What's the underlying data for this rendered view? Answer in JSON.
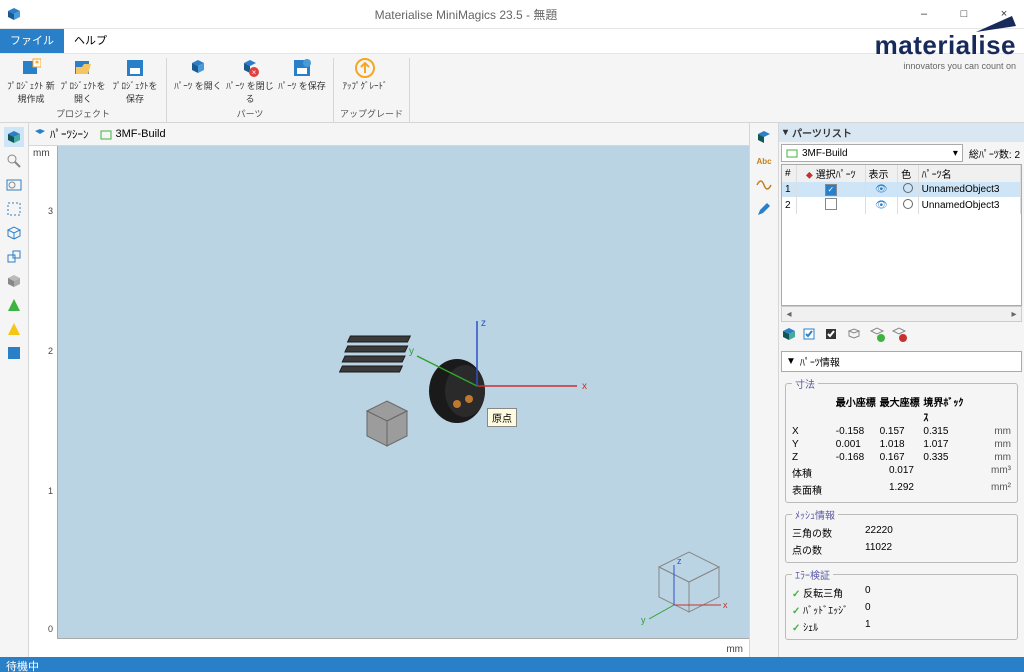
{
  "window": {
    "title": "Materialise MiniMagics 23.5 - 無題",
    "minimize": "–",
    "maximize": "□",
    "close": "×"
  },
  "menu": {
    "file": "ファイル",
    "help": "ヘルプ"
  },
  "ribbon": {
    "project": {
      "label": "プロジェクト",
      "new": "ﾌﾟﾛｼﾞｪｸﾄ 新規作成",
      "open": "ﾌﾟﾛｼﾞｪｸﾄを開く",
      "save": "ﾌﾟﾛｼﾞｪｸﾄを保存"
    },
    "parts": {
      "label": "パーツ",
      "open": "ﾊﾟｰﾂ を開く",
      "close": "ﾊﾟｰﾂ を閉じる",
      "save": "ﾊﾟｰﾂ を保存"
    },
    "upgrade": {
      "label": "アップグレード",
      "btn": "ｱｯﾌﾟｸﾞﾚｰﾄﾞ"
    }
  },
  "logo": {
    "brand": "materialise",
    "tag": "innovators you can count on"
  },
  "tabs": {
    "scene": "ﾊﾟｰﾂｼｰﾝ",
    "build": "3MF-Build"
  },
  "ruler": {
    "unit": "mm",
    "y": [
      "0",
      "1",
      "2",
      "3"
    ]
  },
  "origin_tooltip": "原点",
  "axis": {
    "x": "x",
    "y": "y",
    "z": "z"
  },
  "parts_panel": {
    "title": "パーツリスト",
    "build": "3MF-Build",
    "count_label": "総ﾊﾟｰﾂ数:",
    "count": "2",
    "cols": {
      "num": "#",
      "sel": "選択ﾊﾟｰﾂ",
      "vis": "表示",
      "col": "色",
      "name": "ﾊﾟｰﾂ名"
    },
    "rows": [
      {
        "n": "1",
        "sel": true,
        "name": "UnnamedObject3"
      },
      {
        "n": "2",
        "sel": false,
        "name": "UnnamedObject3"
      }
    ]
  },
  "info_panel": {
    "title": "ﾊﾟｰﾂ情報",
    "dims": {
      "legend": "寸法",
      "min": "最小座標",
      "max": "最大座標",
      "box": "境界ﾎﾞｯｸｽ",
      "X": {
        "min": "-0.158",
        "max": "0.157",
        "box": "0.315"
      },
      "Y": {
        "min": "0.001",
        "max": "1.018",
        "box": "1.017"
      },
      "Z": {
        "min": "-0.168",
        "max": "0.167",
        "box": "0.335"
      },
      "vol_l": "体積",
      "vol": "0.017",
      "vol_u": "mm³",
      "area_l": "表面積",
      "area": "1.292",
      "area_u": "mm²",
      "u": "mm"
    },
    "mesh": {
      "legend": "ﾒｯｼｭ情報",
      "tri_l": "三角の数",
      "tri": "22220",
      "pts_l": "点の数",
      "pts": "11022"
    },
    "err": {
      "legend": "ｴﾗｰ検証",
      "inv_l": "反転三角",
      "inv": "0",
      "bad_l": "ﾊﾞｯﾄﾞｴｯｼﾞ",
      "bad": "0",
      "shell_l": "ｼｪﾙ",
      "shell": "1"
    }
  },
  "status": "待機中"
}
